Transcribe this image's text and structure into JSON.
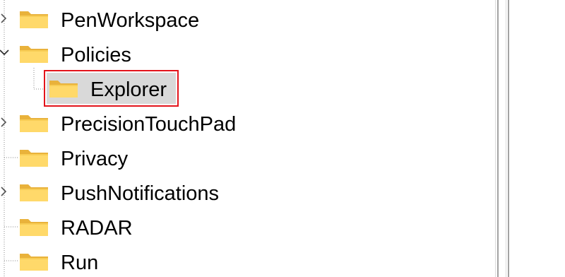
{
  "tree": {
    "items": [
      {
        "label": "PenWorkspace",
        "expander": "collapsed",
        "icon": "folder-icon"
      },
      {
        "label": "Policies",
        "expander": "expanded",
        "icon": "folder-icon"
      },
      {
        "label": "Explorer",
        "expander": "none",
        "icon": "folder-icon",
        "selected": true
      },
      {
        "label": "PrecisionTouchPad",
        "expander": "collapsed",
        "icon": "folder-icon"
      },
      {
        "label": "Privacy",
        "expander": "none",
        "icon": "folder-icon"
      },
      {
        "label": "PushNotifications",
        "expander": "collapsed",
        "icon": "folder-icon"
      },
      {
        "label": "RADAR",
        "expander": "none",
        "icon": "folder-icon"
      },
      {
        "label": "Run",
        "expander": "none",
        "icon": "folder-icon"
      }
    ]
  },
  "colors": {
    "folder_body": "#f8cd55",
    "folder_tab": "#e9b23b",
    "folder_front": "#ffd96a",
    "selection_outline": "#e3141b",
    "selection_fill": "#d9d9d9",
    "tree_line": "#8a8a8a"
  }
}
